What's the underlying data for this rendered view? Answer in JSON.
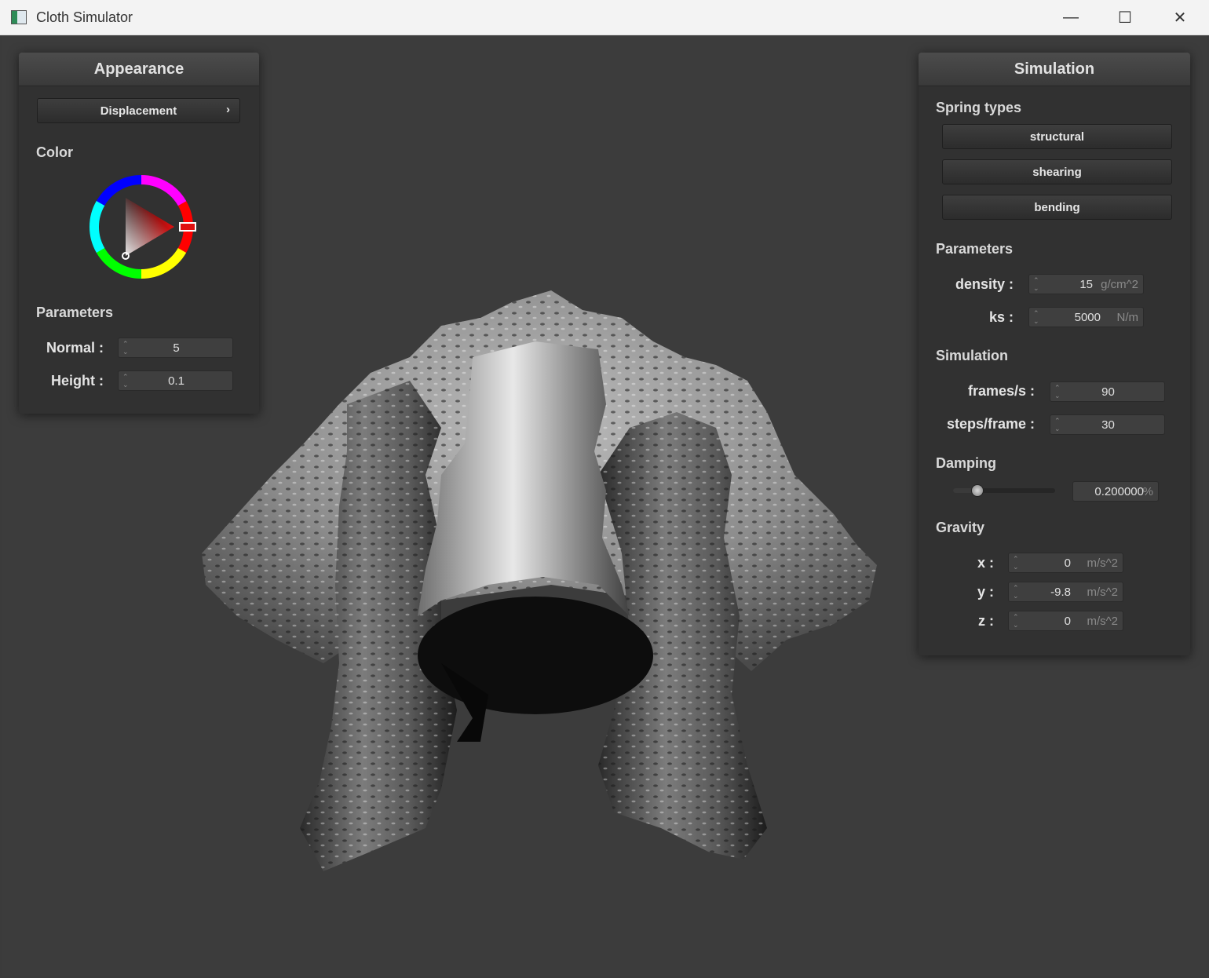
{
  "window": {
    "title": "Cloth Simulator",
    "minimize": "—",
    "maximize": "☐",
    "close": "✕"
  },
  "appearance": {
    "title": "Appearance",
    "shader_button": "Displacement",
    "shader_chevron": "›",
    "color_label": "Color",
    "color_value": "#e01010",
    "parameters_label": "Parameters",
    "normal_label": "Normal :",
    "normal_value": "5",
    "height_label": "Height :",
    "height_value": "0.1"
  },
  "simulation": {
    "title": "Simulation",
    "spring_types_label": "Spring types",
    "spring_types": [
      "structural",
      "shearing",
      "bending"
    ],
    "parameters_label": "Parameters",
    "density_label": "density :",
    "density_value": "15",
    "density_unit": "g/cm^2",
    "ks_label": "ks :",
    "ks_value": "5000",
    "ks_unit": "N/m",
    "simulation_label": "Simulation",
    "fps_label": "frames/s :",
    "fps_value": "90",
    "steps_label": "steps/frame :",
    "steps_value": "30",
    "damping_label": "Damping",
    "damping_value": "0.200000",
    "damping_unit": "%",
    "damping_slider_fraction": 0.2,
    "gravity_label": "Gravity",
    "gx_label": "x :",
    "gx_value": "0",
    "gy_label": "y :",
    "gy_value": "-9.8",
    "gz_label": "z :",
    "gz_value": "0",
    "gravity_unit": "m/s^2"
  }
}
